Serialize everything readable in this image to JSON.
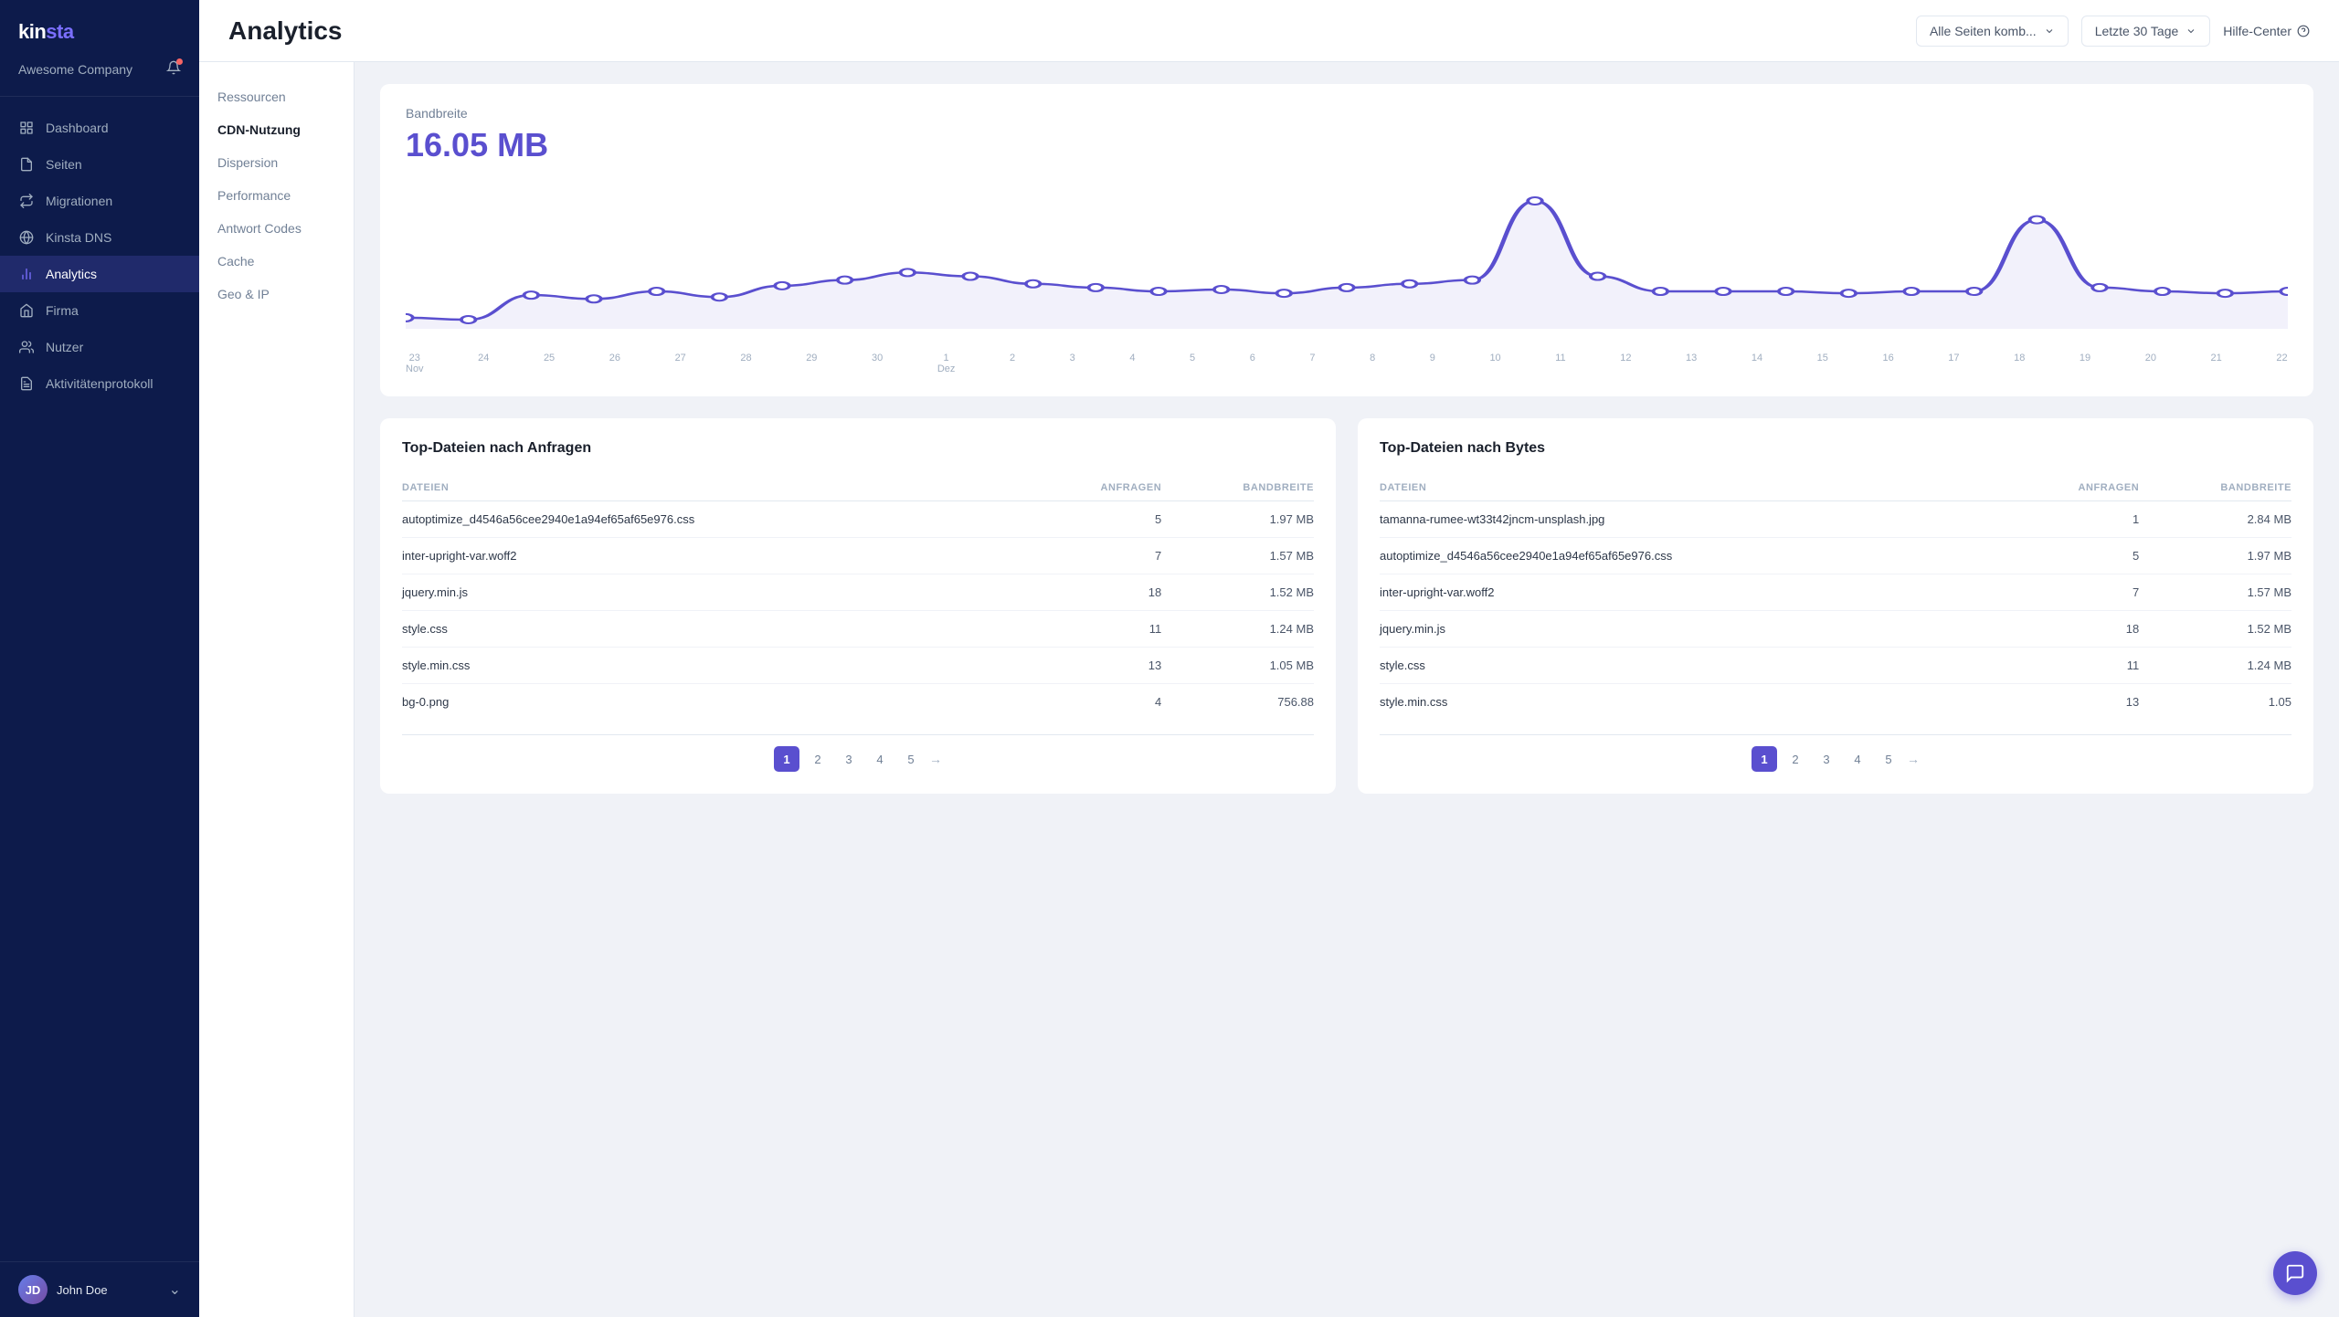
{
  "sidebar": {
    "logo": "kinsta",
    "company": "Awesome Company",
    "nav": [
      {
        "label": "Dashboard",
        "icon": "grid",
        "active": false,
        "id": "dashboard"
      },
      {
        "label": "Seiten",
        "icon": "pages",
        "active": false,
        "id": "seiten"
      },
      {
        "label": "Migrationen",
        "icon": "migrate",
        "active": false,
        "id": "migrationen"
      },
      {
        "label": "Kinsta DNS",
        "icon": "dns",
        "active": false,
        "id": "kinsta-dns"
      },
      {
        "label": "Analytics",
        "icon": "analytics",
        "active": true,
        "id": "analytics"
      },
      {
        "label": "Firma",
        "icon": "company",
        "active": false,
        "id": "firma"
      },
      {
        "label": "Nutzer",
        "icon": "users",
        "active": false,
        "id": "nutzer"
      },
      {
        "label": "Aktivitätenprotokoll",
        "icon": "log",
        "active": false,
        "id": "aktivitaeten"
      }
    ],
    "user": {
      "name": "John Doe",
      "initials": "JD"
    }
  },
  "header": {
    "title": "Analytics",
    "dropdown1": {
      "label": "Alle Seiten komb..."
    },
    "dropdown2": {
      "label": "Letzte 30 Tage"
    },
    "help": "Hilfe-Center"
  },
  "subNav": [
    {
      "label": "Ressourcen",
      "active": false
    },
    {
      "label": "CDN-Nutzung",
      "active": true
    },
    {
      "label": "Dispersion",
      "active": false
    },
    {
      "label": "Performance",
      "active": false
    },
    {
      "label": "Antwort Codes",
      "active": false
    },
    {
      "label": "Cache",
      "active": false
    },
    {
      "label": "Geo & IP",
      "active": false
    }
  ],
  "bandwidth": {
    "label": "Bandbreite",
    "value": "16.05 MB"
  },
  "chart": {
    "xLabels": [
      "23\nNov",
      "24",
      "25",
      "26",
      "27",
      "28",
      "29",
      "30",
      "1\nDez",
      "2",
      "3",
      "4",
      "5",
      "6",
      "7",
      "8",
      "9",
      "10",
      "11",
      "12",
      "13",
      "14",
      "15",
      "16",
      "17",
      "18",
      "19",
      "20",
      "21",
      "22"
    ],
    "points": [
      8,
      7,
      20,
      18,
      22,
      19,
      25,
      28,
      32,
      30,
      26,
      24,
      22,
      23,
      21,
      24,
      26,
      28,
      70,
      30,
      22,
      22,
      22,
      21,
      22,
      22,
      60,
      24,
      22,
      21,
      22
    ]
  },
  "table1": {
    "title": "Top-Dateien nach Anfragen",
    "columns": [
      "DATEIEN",
      "ANFRAGEN",
      "BANDBREITE"
    ],
    "rows": [
      {
        "file": "autoptimize_d4546a56cee2940e1a94ef65af65e976.css",
        "requests": "5",
        "bandwidth": "1.97 MB"
      },
      {
        "file": "inter-upright-var.woff2",
        "requests": "7",
        "bandwidth": "1.57 MB"
      },
      {
        "file": "jquery.min.js",
        "requests": "18",
        "bandwidth": "1.52 MB"
      },
      {
        "file": "style.css",
        "requests": "11",
        "bandwidth": "1.24 MB"
      },
      {
        "file": "style.min.css",
        "requests": "13",
        "bandwidth": "1.05 MB"
      },
      {
        "file": "bg-0.png",
        "requests": "4",
        "bandwidth": "756.88"
      }
    ],
    "pagination": [
      "1",
      "2",
      "3",
      "4",
      "5"
    ]
  },
  "table2": {
    "title": "Top-Dateien nach Bytes",
    "columns": [
      "DATEIEN",
      "ANFRAGEN",
      "BANDBREITE"
    ],
    "rows": [
      {
        "file": "tamanna-rumee-wt33t42jncm-unsplash.jpg",
        "requests": "1",
        "bandwidth": "2.84 MB"
      },
      {
        "file": "autoptimize_d4546a56cee2940e1a94ef65af65e976.css",
        "requests": "5",
        "bandwidth": "1.97 MB"
      },
      {
        "file": "inter-upright-var.woff2",
        "requests": "7",
        "bandwidth": "1.57 MB"
      },
      {
        "file": "jquery.min.js",
        "requests": "18",
        "bandwidth": "1.52 MB"
      },
      {
        "file": "style.css",
        "requests": "11",
        "bandwidth": "1.24 MB"
      },
      {
        "file": "style.min.css",
        "requests": "13",
        "bandwidth": "1.05"
      }
    ],
    "pagination": [
      "1",
      "2",
      "3",
      "4",
      "5"
    ]
  },
  "colors": {
    "accent": "#5a4fcf",
    "sidebarBg": "#0d1b4b",
    "chartLine": "#5a4fcf"
  }
}
